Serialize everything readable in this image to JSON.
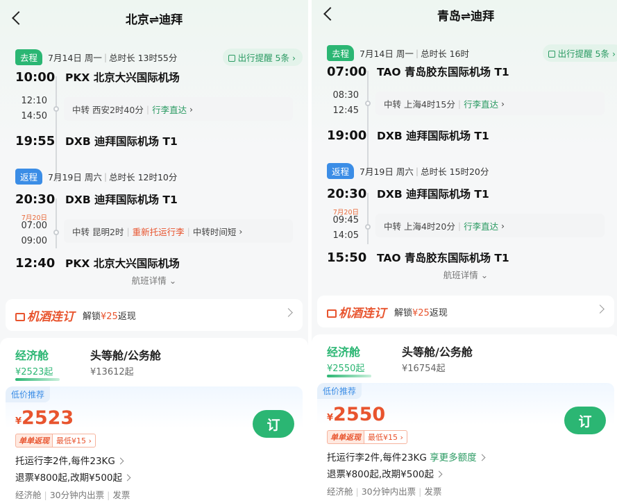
{
  "left": {
    "title": "北京⇌迪拜",
    "remind": "出行提醒 5条",
    "outbound": {
      "tag": "去程",
      "date": "7月14日",
      "weekday": "周一",
      "duration": "总时长 13时55分",
      "dep_time": "10:00",
      "dep_airport": "PKX 北京大兴国际机场",
      "arr_mid": "12:10",
      "dep_mid": "14:50",
      "mid_date": "",
      "transfer": "中转 西安2时40分",
      "transfer_note1": "行李直达",
      "transfer_note2": "",
      "arr_time": "19:55",
      "arr_airport": "DXB 迪拜国际机场 T1"
    },
    "return": {
      "tag": "返程",
      "date": "7月19日",
      "weekday": "周六",
      "duration": "总时长 12时10分",
      "dep_time": "20:30",
      "dep_airport": "DXB 迪拜国际机场 T1",
      "mid_date": "7月20日",
      "arr_mid": "07:00",
      "dep_mid": "09:00",
      "transfer": "中转 昆明2时",
      "transfer_note_red": "重新托运行李",
      "transfer_note2": "中转时间短",
      "arr_time": "12:40",
      "arr_airport": "PKX 北京大兴国际机场"
    },
    "details": "航班详情",
    "promo": {
      "logo": "机酒连订",
      "prefix": "解锁",
      "amount": "¥25",
      "suffix": "返现"
    },
    "cabins": {
      "economy_name": "经济舱",
      "economy_price": "¥2523起",
      "first_name": "头等舱/公务舱",
      "first_price": "¥13612起"
    },
    "offer": {
      "tag": "低价推荐",
      "yen": "¥",
      "price": "2523",
      "badge1": "单单返现",
      "badge2": "最低¥15",
      "book": "订",
      "baggage": "托运行李2件,每件23KG",
      "baggage_extra": "",
      "refund": "退票¥800起,改期¥500起",
      "foot1": "经济舱",
      "foot2": "30分钟内出票",
      "foot3": "发票"
    }
  },
  "right": {
    "title": "青岛⇌迪拜",
    "remind": "出行提醒 5条",
    "outbound": {
      "tag": "去程",
      "date": "7月14日",
      "weekday": "周一",
      "duration": "总时长 16时",
      "dep_time": "07:00",
      "dep_airport": "TAO 青岛胶东国际机场 T1",
      "arr_mid": "08:30",
      "dep_mid": "12:45",
      "transfer": "中转 上海4时15分",
      "transfer_note1": "行李直达",
      "arr_time": "19:00",
      "arr_airport": "DXB 迪拜国际机场 T1"
    },
    "return": {
      "tag": "返程",
      "date": "7月19日",
      "weekday": "周六",
      "duration": "总时长 15时20分",
      "dep_time": "20:30",
      "dep_airport": "DXB 迪拜国际机场 T1",
      "mid_date": "7月20日",
      "arr_mid": "09:45",
      "dep_mid": "14:05",
      "transfer": "中转 上海4时20分",
      "transfer_note1": "行李直达",
      "arr_time": "15:50",
      "arr_airport": "TAO 青岛胶东国际机场 T1"
    },
    "details": "航班详情",
    "promo": {
      "logo": "机酒连订",
      "prefix": "解锁",
      "amount": "¥25",
      "suffix": "返现"
    },
    "cabins": {
      "economy_name": "经济舱",
      "economy_price": "¥2550起",
      "first_name": "头等舱/公务舱",
      "first_price": "¥16754起"
    },
    "offer": {
      "tag": "低价推荐",
      "yen": "¥",
      "price": "2550",
      "badge1": "单单返现",
      "badge2": "最低¥15",
      "book": "订",
      "baggage": "托运行李2件,每件23KG",
      "baggage_extra": "享更多额度",
      "refund": "退票¥800起,改期¥500起",
      "foot1": "经济舱",
      "foot2": "30分钟内出票",
      "foot3": "发票"
    }
  },
  "colors": {
    "accent_green": "#2bb673",
    "return_blue": "#3b8de6",
    "price_orange": "#e8542e"
  }
}
